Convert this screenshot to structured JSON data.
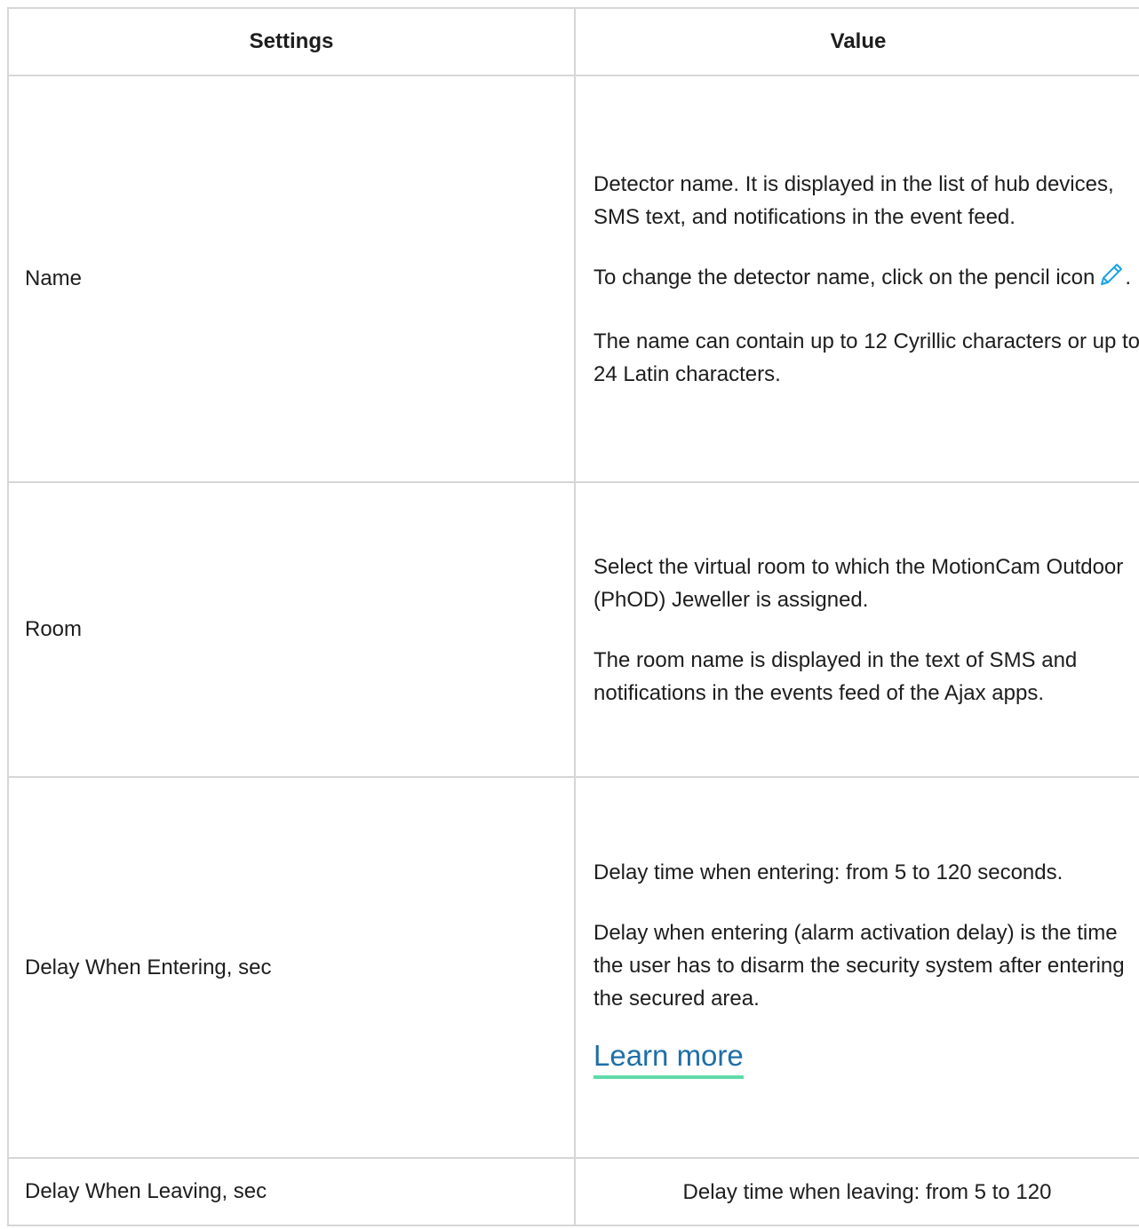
{
  "table": {
    "headers": {
      "setting": "Settings",
      "value": "Value"
    },
    "rows": [
      {
        "setting": "Name",
        "paragraphs": [
          "Detector name. It is displayed in the list of hub devices, SMS text, and notifications in the event feed.",
          "To change the detector name, click on the pencil icon",
          "The name can contain up to 12 Cyrillic characters or up to 24 Latin characters."
        ],
        "pencil_icon": "pencil-icon",
        "pencil_suffix": "."
      },
      {
        "setting": "Room",
        "paragraphs": [
          "Select the virtual room to which the MotionCam Outdoor (PhOD) Jeweller is assigned.",
          "The room name is displayed in the text of SMS and notifications in the events feed of the Ajax apps."
        ]
      },
      {
        "setting": "Delay When Entering, sec",
        "paragraphs": [
          "Delay time when entering: from 5 to 120 seconds.",
          "Delay when entering (alarm activation delay) is the time the user has to disarm the security system after entering the secured area."
        ],
        "link": "Learn more"
      },
      {
        "setting": "Delay When Leaving, sec",
        "paragraphs": [
          "Delay time when leaving: from 5 to 120"
        ]
      }
    ]
  },
  "colors": {
    "border": "#d6d6d6",
    "text": "#1d1d1d",
    "link": "#1e6fa8",
    "link_underline": "#5fdba7",
    "icon": "#1aa3e8"
  }
}
